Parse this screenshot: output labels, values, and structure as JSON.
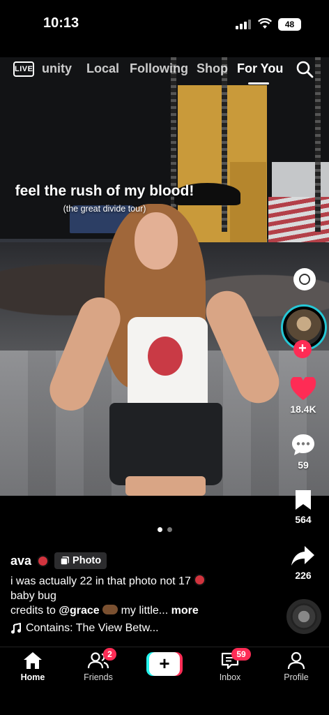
{
  "status_bar": {
    "time": "10:13",
    "battery": "48"
  },
  "top_nav": {
    "live_label": "LIVE",
    "tabs": [
      {
        "label": "unity"
      },
      {
        "label": "Local"
      },
      {
        "label": "Following"
      },
      {
        "label": "Shop"
      },
      {
        "label": "For You",
        "active": true
      }
    ]
  },
  "overlay_caption": {
    "main": "feel the rush of my blood!",
    "sub": "(the great divide tour)"
  },
  "actions": {
    "likes": "18.4K",
    "comments": "59",
    "saves": "564",
    "shares": "226"
  },
  "post": {
    "username": "ava",
    "badge_label": "Photo",
    "desc_line1": "i was actually 22 in that photo not 17",
    "desc_line2": "baby bug",
    "credits_prefix": "credits to",
    "mention": "@grace",
    "desc_tail": "my little...",
    "more": "more",
    "sound": "Contains: The View Betw..."
  },
  "bottom_nav": {
    "home": "Home",
    "friends": "Friends",
    "friends_badge": "2",
    "inbox": "Inbox",
    "inbox_badge": "59",
    "profile": "Profile",
    "create": "+"
  },
  "colors": {
    "accent_red": "#fe2c55",
    "accent_cyan": "#25f4ee",
    "avatar_ring": "#25c7d6"
  }
}
